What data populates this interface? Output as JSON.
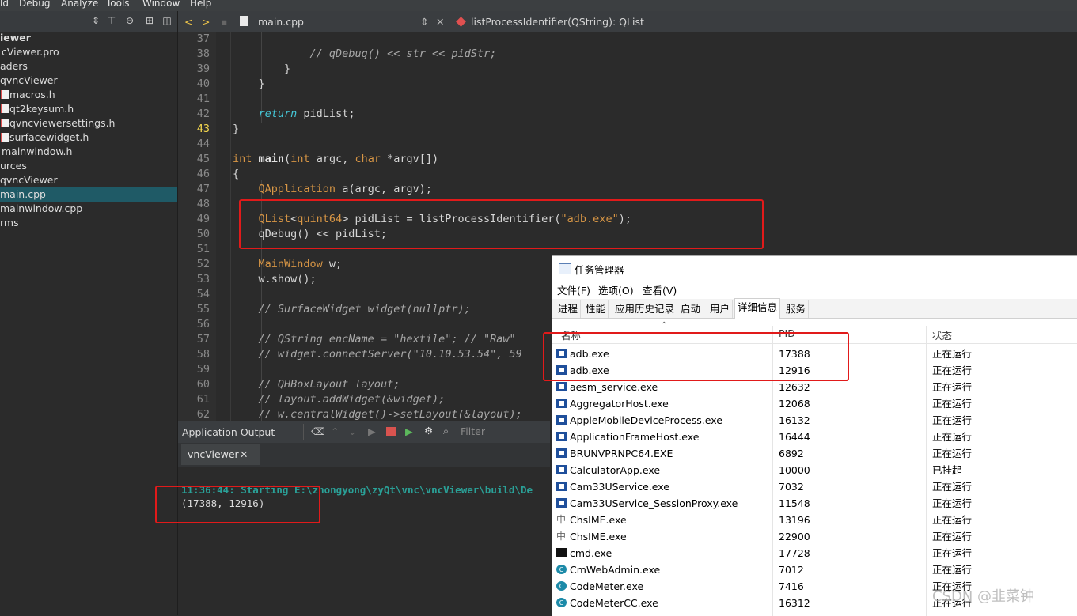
{
  "menu": [
    "ld",
    "Debug",
    "Analyze",
    "Tools",
    "Window",
    "Help"
  ],
  "editor_toolbar": {
    "file": "main.cpp",
    "function": "listProcessIdentifier(QString): QList"
  },
  "project_tree": [
    {
      "label": "iewer",
      "bold": true,
      "sel": false
    },
    {
      "label": "cViewer.pro",
      "sel": false
    },
    {
      "label": "aders",
      "sel": false
    },
    {
      "label": "qvncViewer",
      "sel": false
    },
    {
      "label": "macros.h",
      "file": true,
      "sel": false
    },
    {
      "label": "qt2keysum.h",
      "file": true,
      "sel": false
    },
    {
      "label": "qvncviewersettings.h",
      "file": true,
      "sel": false
    },
    {
      "label": "surfacewidget.h",
      "file": true,
      "sel": false
    },
    {
      "label": "mainwindow.h",
      "sel": false
    },
    {
      "label": "urces",
      "sel": false
    },
    {
      "label": "qvncViewer",
      "sel": false
    },
    {
      "label": "main.cpp",
      "sel": true
    },
    {
      "label": "mainwindow.cpp",
      "sel": false
    },
    {
      "label": "rms",
      "sel": false
    }
  ],
  "code_lines": [
    {
      "n": "37",
      "html": ""
    },
    {
      "n": "38",
      "html": "            <span class=\"cm\">// qDebug() &lt;&lt; str &lt;&lt; pidStr;</span>"
    },
    {
      "n": "39",
      "html": "        }"
    },
    {
      "n": "40",
      "html": "    }"
    },
    {
      "n": "41",
      "html": ""
    },
    {
      "n": "42",
      "html": "    <span class=\"ret\">return</span> pidList;"
    },
    {
      "n": "43",
      "html": "}",
      "cur": true
    },
    {
      "n": "44",
      "html": ""
    },
    {
      "n": "45",
      "html": "<span class=\"kw\">int</span> <span class=\"fn\">main</span>(<span class=\"kw\">int</span> argc, <span class=\"kw\">char</span> *argv[])"
    },
    {
      "n": "46",
      "html": "{"
    },
    {
      "n": "47",
      "html": "    <span class=\"ty\">QApplication</span> a(argc, argv);"
    },
    {
      "n": "48",
      "html": ""
    },
    {
      "n": "49",
      "html": "    <span class=\"ty\">QList</span>&lt;<span class=\"ty\">quint64</span>&gt; pidList = listProcessIdentifier(<span class=\"st\">\"adb.exe\"</span>);"
    },
    {
      "n": "50",
      "html": "    qDebug() &lt;&lt; pidList;"
    },
    {
      "n": "51",
      "html": ""
    },
    {
      "n": "52",
      "html": "    <span class=\"ty\">MainWindow</span> w;"
    },
    {
      "n": "53",
      "html": "    w.show();"
    },
    {
      "n": "54",
      "html": ""
    },
    {
      "n": "55",
      "html": "    <span class=\"cm\">// SurfaceWidget widget(nullptr);</span>"
    },
    {
      "n": "56",
      "html": ""
    },
    {
      "n": "57",
      "html": "    <span class=\"cm\">// QString encName = \"hextile\"; // \"Raw\"</span>"
    },
    {
      "n": "58",
      "html": "    <span class=\"cm\">// widget.connectServer(\"10.10.53.54\", 59</span>"
    },
    {
      "n": "59",
      "html": ""
    },
    {
      "n": "60",
      "html": "    <span class=\"cm\">// QHBoxLayout layout;</span>"
    },
    {
      "n": "61",
      "html": "    <span class=\"cm\">// layout.addWidget(&amp;widget);</span>"
    },
    {
      "n": "62",
      "html": "    <span class=\"cm\">// w.centralWidget()-&gt;setLayout(&amp;layout);</span>"
    }
  ],
  "output": {
    "panel_title": "Application Output",
    "filter_placeholder": "Filter",
    "tab": "vncViewer",
    "line1": "11:36:44: Starting E:\\zhongyong\\zyQt\\vnc\\vncViewer\\build\\De",
    "line2": "(17388, 12916)"
  },
  "task_manager": {
    "title": "任务管理器",
    "menus": [
      "文件(F)",
      "选项(O)",
      "查看(V)"
    ],
    "tabs": [
      "进程",
      "性能",
      "应用历史记录",
      "启动",
      "用户",
      "详细信息",
      "服务"
    ],
    "active_tab": "详细信息",
    "columns": [
      "名称",
      "PID",
      "状态"
    ],
    "rows": [
      {
        "name": "adb.exe",
        "pid": "17388",
        "status": "正在运行",
        "icon": "win"
      },
      {
        "name": "adb.exe",
        "pid": "12916",
        "status": "正在运行",
        "icon": "win"
      },
      {
        "name": "aesm_service.exe",
        "pid": "12632",
        "status": "正在运行",
        "icon": "win"
      },
      {
        "name": "AggregatorHost.exe",
        "pid": "12068",
        "status": "正在运行",
        "icon": "win"
      },
      {
        "name": "AppleMobileDeviceProcess.exe",
        "pid": "16132",
        "status": "正在运行",
        "icon": "win"
      },
      {
        "name": "ApplicationFrameHost.exe",
        "pid": "16444",
        "status": "正在运行",
        "icon": "win"
      },
      {
        "name": "BRUNVPRNPC64.EXE",
        "pid": "6892",
        "status": "正在运行",
        "icon": "win"
      },
      {
        "name": "CalculatorApp.exe",
        "pid": "10000",
        "status": "已挂起",
        "icon": "win"
      },
      {
        "name": "Cam33UService.exe",
        "pid": "7032",
        "status": "正在运行",
        "icon": "win"
      },
      {
        "name": "Cam33UService_SessionProxy.exe",
        "pid": "11548",
        "status": "正在运行",
        "icon": "win"
      },
      {
        "name": "ChsIME.exe",
        "pid": "13196",
        "status": "正在运行",
        "icon": "ime"
      },
      {
        "name": "ChsIME.exe",
        "pid": "22900",
        "status": "正在运行",
        "icon": "ime"
      },
      {
        "name": "cmd.exe",
        "pid": "17728",
        "status": "正在运行",
        "icon": "cmd"
      },
      {
        "name": "CmWebAdmin.exe",
        "pid": "7012",
        "status": "正在运行",
        "icon": "cm2"
      },
      {
        "name": "CodeMeter.exe",
        "pid": "7416",
        "status": "正在运行",
        "icon": "cm2"
      },
      {
        "name": "CodeMeterCC.exe",
        "pid": "16312",
        "status": "正在运行",
        "icon": "cm2"
      }
    ]
  },
  "watermark": "CSDN @韭菜钟",
  "colors": {
    "highlight_box": "#e11a1a",
    "selection": "#1f5a66"
  }
}
